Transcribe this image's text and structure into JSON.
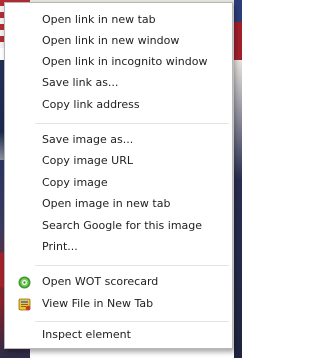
{
  "context_menu": {
    "groups": [
      {
        "items": [
          {
            "label": "Open link in new tab"
          },
          {
            "label": "Open link in new window"
          },
          {
            "label": "Open link in incognito window"
          },
          {
            "label": "Save link as..."
          },
          {
            "label": "Copy link address"
          }
        ]
      },
      {
        "items": [
          {
            "label": "Save image as..."
          },
          {
            "label": "Copy image URL"
          },
          {
            "label": "Copy image"
          },
          {
            "label": "Open image in new tab"
          },
          {
            "label": "Search Google for this image"
          },
          {
            "label": "Print..."
          }
        ]
      },
      {
        "items": [
          {
            "label": "Open WOT scorecard",
            "icon": "wot-icon"
          },
          {
            "label": "View File in New Tab",
            "icon": "view-file-icon"
          }
        ]
      },
      {
        "items": [
          {
            "label": "Inspect element"
          }
        ]
      }
    ]
  },
  "colors": {
    "menu_background": "#ffffff",
    "menu_text": "#222222",
    "separator": "#e4e4e4",
    "menu_border": "#b8b8b8"
  }
}
